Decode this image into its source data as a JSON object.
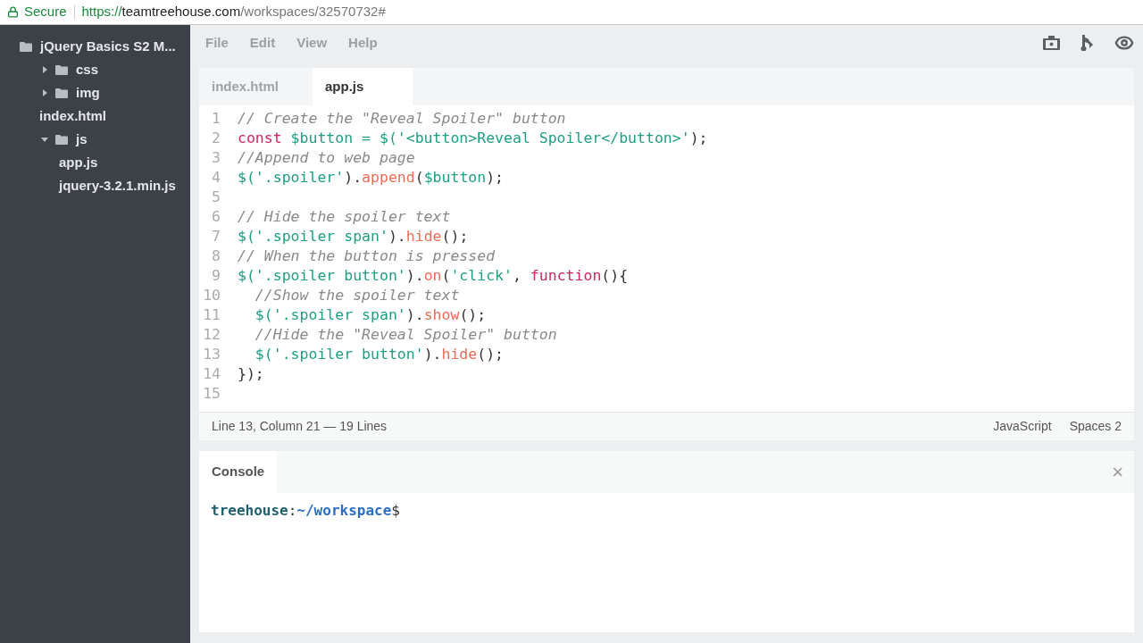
{
  "browser": {
    "secure_label": "Secure",
    "url": {
      "scheme": "https://",
      "host": "teamtreehouse.com",
      "path": "/workspaces/32570732#"
    }
  },
  "sidebar": {
    "items": [
      {
        "label": "jQuery Basics S2 M...",
        "kind": "folder",
        "children": [
          {
            "label": "css",
            "kind": "folder",
            "expanded": false
          },
          {
            "label": "img",
            "kind": "folder",
            "expanded": false
          },
          {
            "label": "index.html",
            "kind": "file"
          },
          {
            "label": "js",
            "kind": "folder",
            "expanded": true,
            "children": [
              {
                "label": "app.js",
                "kind": "file"
              },
              {
                "label": "jquery-3.2.1.min.js",
                "kind": "file"
              }
            ]
          }
        ]
      }
    ]
  },
  "menu": [
    "File",
    "Edit",
    "View",
    "Help"
  ],
  "tabs": [
    {
      "label": "index.html",
      "selected": false
    },
    {
      "label": "app.js",
      "selected": true
    }
  ],
  "editor": {
    "lines": [
      {
        "number": "1",
        "tokens": [
          {
            "kind": "comment",
            "text": "// Create the \"Reveal Spoiler\" button"
          }
        ]
      },
      {
        "number": "2",
        "tokens": [
          {
            "kind": "keyword",
            "text": "const "
          },
          {
            "kind": "teal",
            "text": "$button = $('<button>Reveal Spoiler</button>'"
          },
          {
            "kind": "plain",
            "text": ");"
          }
        ]
      },
      {
        "number": "3",
        "tokens": [
          {
            "kind": "comment",
            "text": "//Append to web page"
          }
        ]
      },
      {
        "number": "4",
        "tokens": [
          {
            "kind": "teal",
            "text": "$('.spoiler'"
          },
          {
            "kind": "plain",
            "text": ")."
          },
          {
            "kind": "method",
            "text": "append"
          },
          {
            "kind": "plain",
            "text": "("
          },
          {
            "kind": "teal",
            "text": "$button"
          },
          {
            "kind": "plain",
            "text": ");"
          }
        ]
      },
      {
        "number": "5"
      },
      {
        "number": "6",
        "tokens": [
          {
            "kind": "comment",
            "text": "// Hide the spoiler text"
          }
        ]
      },
      {
        "number": "7",
        "tokens": [
          {
            "kind": "teal",
            "text": "$('.spoiler span'"
          },
          {
            "kind": "plain",
            "text": ")."
          },
          {
            "kind": "method",
            "text": "hide"
          },
          {
            "kind": "plain",
            "text": "();"
          }
        ]
      },
      {
        "number": "8",
        "tokens": [
          {
            "kind": "comment",
            "text": "// When the button is pressed"
          }
        ]
      },
      {
        "number": "9",
        "tokens": [
          {
            "kind": "teal",
            "text": "$('.spoiler button'"
          },
          {
            "kind": "plain",
            "text": ")."
          },
          {
            "kind": "method",
            "text": "on"
          },
          {
            "kind": "plain",
            "text": "("
          },
          {
            "kind": "teal",
            "text": "'click'"
          },
          {
            "kind": "plain",
            "text": ", "
          },
          {
            "kind": "keyword",
            "text": "function"
          },
          {
            "kind": "plain",
            "text": "(){"
          }
        ]
      },
      {
        "number": "10",
        "tokens": [
          {
            "kind": "comment",
            "text": "  //Show the spoiler text"
          }
        ]
      },
      {
        "number": "11",
        "tokens": [
          {
            "kind": "teal",
            "text": "  $('.spoiler span'"
          },
          {
            "kind": "plain",
            "text": ")."
          },
          {
            "kind": "method",
            "text": "show"
          },
          {
            "kind": "plain",
            "text": "();"
          }
        ]
      },
      {
        "number": "12",
        "tokens": [
          {
            "kind": "comment",
            "text": "  //Hide the \"Reveal Spoiler\" button"
          }
        ]
      },
      {
        "number": "13",
        "tokens": [
          {
            "kind": "teal",
            "text": "  $('.spoiler button'"
          },
          {
            "kind": "plain",
            "text": ")."
          },
          {
            "kind": "method",
            "text": "hide"
          },
          {
            "kind": "plain",
            "text": "();"
          }
        ]
      },
      {
        "number": "14",
        "tokens": [
          {
            "kind": "plain",
            "text": "});"
          }
        ]
      },
      {
        "number": "15"
      }
    ]
  },
  "status_bar": {
    "position": "Line 13, Column 21 — 19 Lines",
    "language": "JavaScript",
    "indent": "Spaces 2"
  },
  "console": {
    "tab": "Console",
    "close": "×",
    "prompt": {
      "user": "treehouse",
      "separator": ":",
      "path": "~/workspace",
      "symbol": "$"
    }
  }
}
